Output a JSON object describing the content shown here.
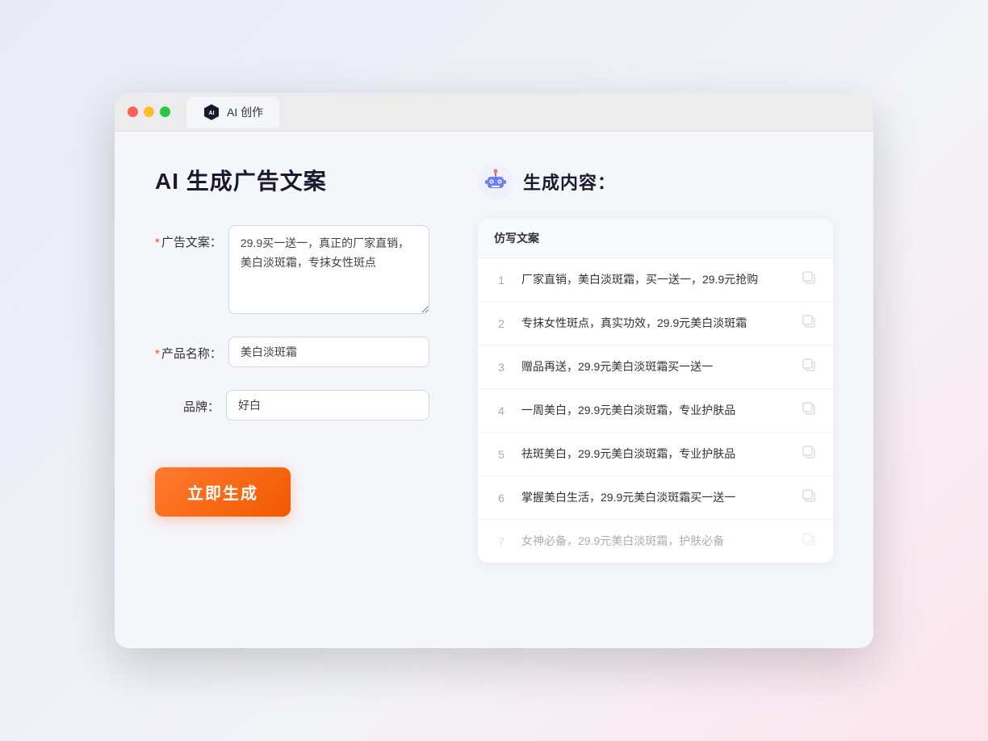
{
  "window": {
    "tab_label": "AI 创作",
    "title_bar": {
      "lights": [
        "red",
        "yellow",
        "green"
      ]
    }
  },
  "left_panel": {
    "page_title": "AI 生成广告文案",
    "form": {
      "ad_copy_label": "广告文案：",
      "ad_copy_required": "*",
      "ad_copy_value": "29.9买一送一，真正的厂家直销，美白淡斑霜，专抹女性斑点",
      "product_name_label": "产品名称：",
      "product_name_required": "*",
      "product_name_value": "美白淡斑霜",
      "brand_label": "品牌：",
      "brand_value": "好白"
    },
    "generate_button": "立即生成"
  },
  "right_panel": {
    "result_title": "生成内容：",
    "column_header": "仿写文案",
    "items": [
      {
        "num": 1,
        "text": "厂家直销，美白淡斑霜，买一送一，29.9元抢购",
        "faded": false
      },
      {
        "num": 2,
        "text": "专抹女性斑点，真实功效，29.9元美白淡斑霜",
        "faded": false
      },
      {
        "num": 3,
        "text": "赠品再送，29.9元美白淡斑霜买一送一",
        "faded": false
      },
      {
        "num": 4,
        "text": "一周美白，29.9元美白淡斑霜，专业护肤品",
        "faded": false
      },
      {
        "num": 5,
        "text": "祛斑美白，29.9元美白淡斑霜，专业护肤品",
        "faded": false
      },
      {
        "num": 6,
        "text": "掌握美白生活，29.9元美白淡斑霜买一送一",
        "faded": false
      },
      {
        "num": 7,
        "text": "女神必备，29.9元美白淡斑霜，护肤必备",
        "faded": true
      }
    ]
  }
}
